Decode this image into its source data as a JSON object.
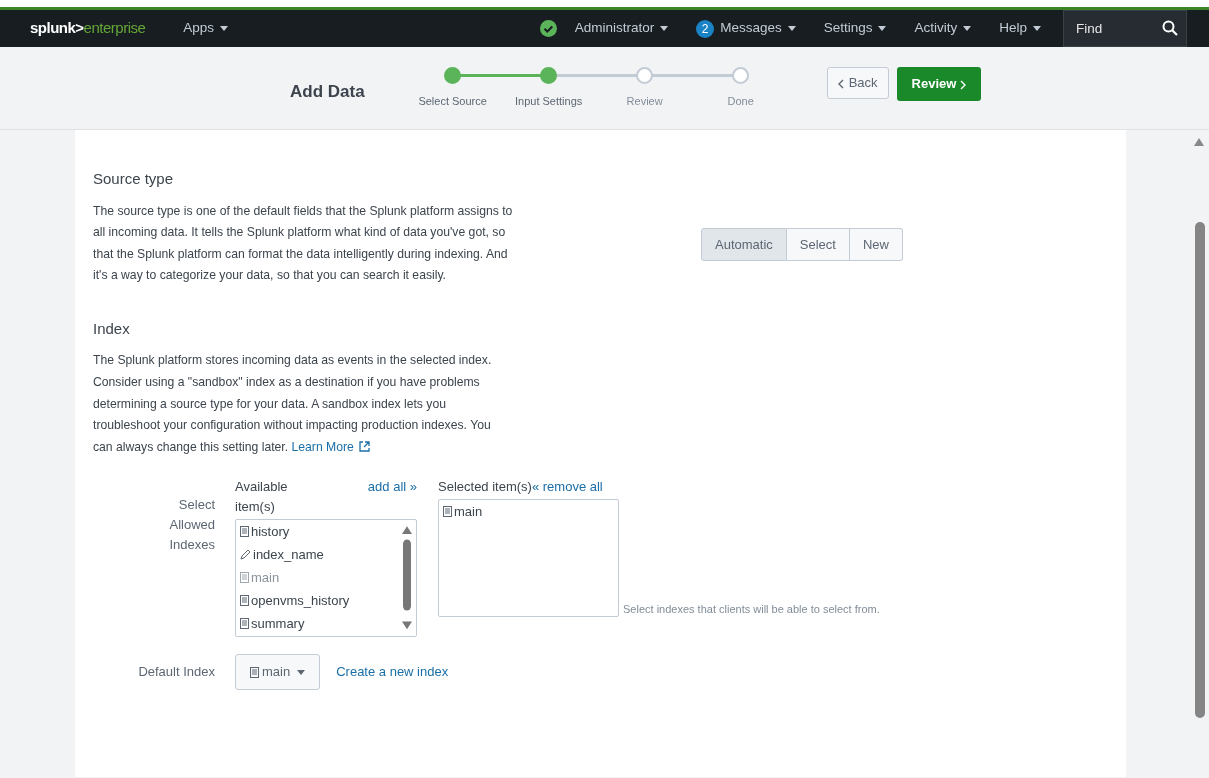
{
  "navbar": {
    "logo_main": "splunk>",
    "logo_sub": "enterprise",
    "items": [
      {
        "kind": "menu",
        "label": "Apps"
      },
      {
        "kind": "status",
        "label": "Administrator"
      },
      {
        "kind": "badge",
        "badge": "2",
        "label": "Messages"
      },
      {
        "kind": "menu",
        "label": "Settings"
      },
      {
        "kind": "menu",
        "label": "Activity"
      },
      {
        "kind": "menu",
        "label": "Help"
      }
    ],
    "search": {
      "placeholder": "Find"
    }
  },
  "header": {
    "title": "Add Data",
    "steps": [
      {
        "label": "Select Source",
        "completed": true
      },
      {
        "label": "Input Settings",
        "completed": true
      },
      {
        "label": "Review",
        "completed": false
      },
      {
        "label": "Done",
        "completed": false
      }
    ],
    "back_button": "Back",
    "next_button": "Review"
  },
  "source_type": {
    "heading": "Source type",
    "description": "The source type is one of the default fields that the Splunk platform assigns to all incoming data. It tells the Splunk platform what kind of data you've got, so that the Splunk platform can format the data intelligently during indexing. And it's a way to categorize your data, so that you can search it easily.",
    "options": [
      {
        "label": "Automatic",
        "selected": true
      },
      {
        "label": "Select",
        "selected": false
      },
      {
        "label": "New",
        "selected": false
      }
    ]
  },
  "index": {
    "heading": "Index",
    "description": "The Splunk platform stores incoming data as events in the selected index. Consider using a \"sandbox\" index as a destination if you have problems determining a source type for your data. A sandbox index lets you troubleshoot your configuration without impacting production indexes. You can always change this setting later.",
    "learn_more": "Learn More",
    "allowed": {
      "label": "Select Allowed Indexes",
      "available_heading": "Available item(s)",
      "add_all": "add all »",
      "selected_heading": "Selected item(s)",
      "remove_all": "« remove all",
      "available": [
        {
          "kind": "index",
          "name": "history",
          "disabled": false
        },
        {
          "kind": "pattern",
          "name": "index_name",
          "disabled": false
        },
        {
          "kind": "index",
          "name": "main",
          "disabled": true
        },
        {
          "kind": "index",
          "name": "openvms_history",
          "disabled": false
        },
        {
          "kind": "index",
          "name": "summary",
          "disabled": false
        }
      ],
      "selected": [
        {
          "kind": "index",
          "name": "main"
        }
      ],
      "help": "Select indexes that clients will be able to select from."
    },
    "default": {
      "label": "Default Index",
      "value": "main",
      "create_link": "Create a new index"
    }
  }
}
